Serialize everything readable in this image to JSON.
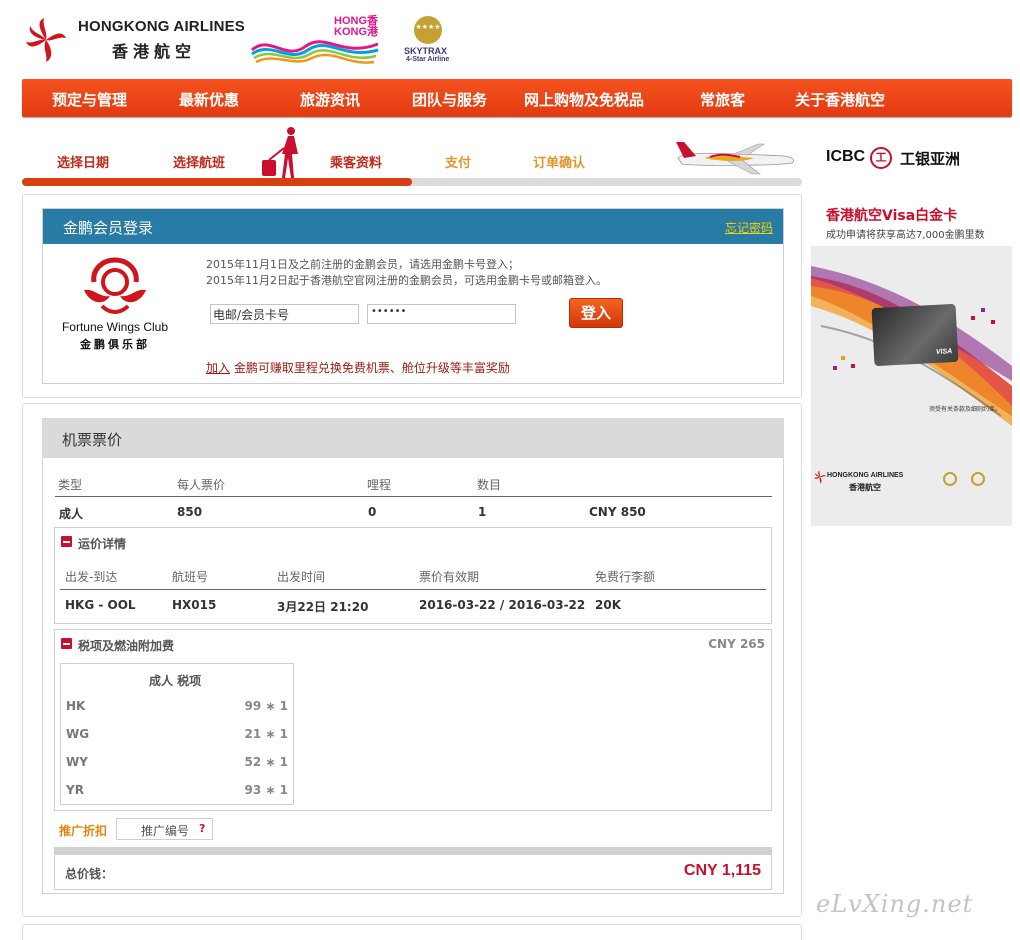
{
  "header": {
    "brand_en": "HONGKONG AIRLINES",
    "brand_cn": "香港航空",
    "hk_logo": "HONG香\nKONG港",
    "skytrax": "SKYTRAX",
    "skytrax_sub": "4-Star Airline"
  },
  "nav": {
    "items": [
      "预定与管理",
      "最新优惠",
      "旅游资讯",
      "团队与服务",
      "网上购物及免税品",
      "常旅客",
      "关于香港航空"
    ]
  },
  "steps": {
    "items": [
      "选择日期",
      "选择航班",
      "乘客资料",
      "支付",
      "订单确认"
    ],
    "current_index": 2,
    "progress_fraction": 0.5
  },
  "ad": {
    "icbc": "ICBC",
    "icbc_symbol": "工",
    "icbc_cn": "工银亚洲",
    "title": "香港航空Visa白金卡",
    "subtitle": "成功申请将获享高达7,000金鹏里数",
    "card_brand": "VISA",
    "terms": "须受有关条款及细则约束。",
    "footer_en": "HONGKONG AIRLINES",
    "footer_cn": "香港航空"
  },
  "login": {
    "title": "金鹏会员登录",
    "forgot": "忘记密码",
    "logo_name": "Fortune Wings Club",
    "logo_cn": "金鹏俱乐部",
    "note1": "2015年11月1日及之前注册的金鹏会员，请选用金鹏卡号登入；",
    "note2": "2015年11月2日起于香港航空官网注册的金鹏会员，可选用金鹏卡号或邮箱登入。",
    "username_value": "电邮/会员卡号",
    "password_value": "••••••",
    "button": "登入",
    "join_link": "加入",
    "join_text": " 金鹏可赚取里程兑换免费机票、舱位升级等丰富奖励"
  },
  "fare": {
    "title": "机票票价",
    "columns": [
      "类型",
      "每人票价",
      "哩程",
      "数目"
    ],
    "row": {
      "type": "成人",
      "price": "850",
      "miles": "0",
      "count": "1",
      "subtotal": "CNY 850"
    },
    "details_title": "运价详情",
    "details_columns": [
      "出发-到达",
      "航班号",
      "出发时间",
      "票价有效期",
      "免费行李额"
    ],
    "details_row": {
      "route": "HKG - OOL",
      "flight": "HX015",
      "departure": "3月22日 21:20",
      "validity": "2016-03-22 / 2016-03-22",
      "baggage": "20K"
    },
    "tax_title": "税项及燃油附加费",
    "tax_total": "CNY 265",
    "tax_table_title": "成人 税项",
    "taxes": [
      {
        "code": "HK",
        "value": "99 ∗ 1"
      },
      {
        "code": "WG",
        "value": "21 ∗ 1"
      },
      {
        "code": "WY",
        "value": "52 ∗ 1"
      },
      {
        "code": "YR",
        "value": "93 ∗ 1"
      }
    ],
    "promo_label": "推广折扣",
    "promo_placeholder": "推广编号",
    "promo_help": "?",
    "total_label": "总价钱：",
    "total_value": "CNY 1,115"
  },
  "watermark": "eLvXing.net",
  "colors": {
    "nav": "#e8431a",
    "login_header": "#287ba5",
    "accent_red": "#c8102e",
    "step_pending": "#e0962c"
  }
}
